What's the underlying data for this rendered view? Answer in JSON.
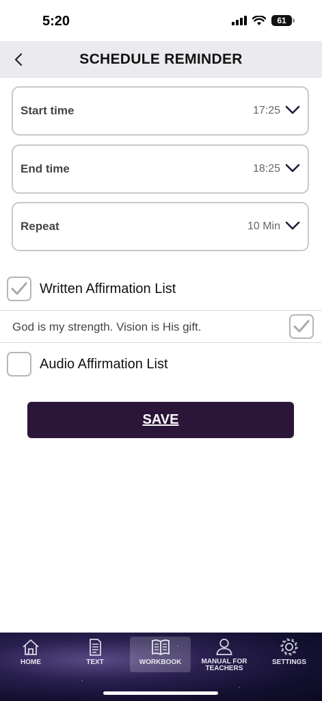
{
  "status_bar": {
    "time": "5:20",
    "battery": "61"
  },
  "header": {
    "title": "SCHEDULE REMINDER",
    "back_icon": "chevron-left-icon"
  },
  "fields": [
    {
      "label": "Start time",
      "value": "17:25"
    },
    {
      "label": "End time",
      "value": "18:25"
    },
    {
      "label": "Repeat",
      "value": "10 Min"
    }
  ],
  "written_list": {
    "label": "Written Affirmation List",
    "checked": true
  },
  "affirmation": {
    "text": "God is my strength. Vision is His gift.",
    "checked": true
  },
  "audio_list": {
    "label": "Audio Affirmation List",
    "checked": false
  },
  "save_label": "SAVE",
  "colors": {
    "accent": "#2b1538",
    "header_bg": "#ebebef",
    "border": "#c8c8c8"
  },
  "tabs": [
    {
      "label": "HOME",
      "icon": "home-icon",
      "active": false
    },
    {
      "label": "TEXT",
      "icon": "document-icon",
      "active": false
    },
    {
      "label": "WORKBOOK",
      "icon": "book-icon",
      "active": true
    },
    {
      "label": "MANUAL FOR TEACHERS",
      "icon": "person-icon",
      "active": false
    },
    {
      "label": "SETTINGS",
      "icon": "gear-icon",
      "active": false
    }
  ]
}
